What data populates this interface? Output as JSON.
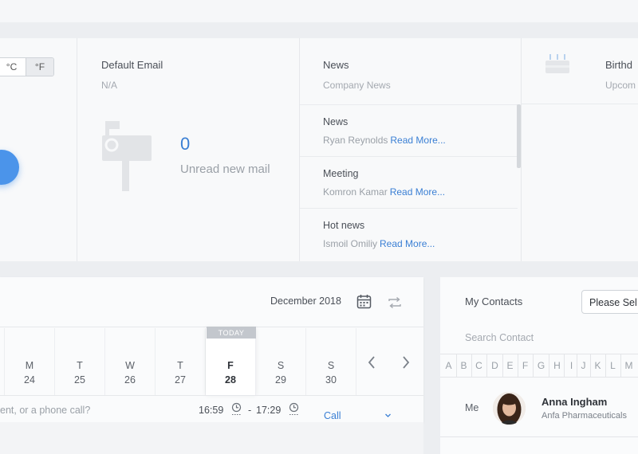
{
  "weather": {
    "units": [
      "°C",
      "°F"
    ],
    "active_unit": "°F"
  },
  "email": {
    "title": "Default Email",
    "address": "N/A",
    "unread_count": "0",
    "unread_caption": "Unread new mail"
  },
  "news": {
    "title": "News",
    "subtitle": "Company News",
    "items": [
      {
        "title": "News",
        "author": "Ryan Reynolds",
        "more": "Read More..."
      },
      {
        "title": "Meeting",
        "author": "Komron Kamar",
        "more": "Read More..."
      },
      {
        "title": "Hot news",
        "author": "Ismoil Omiliy",
        "more": "Read More..."
      }
    ]
  },
  "birthdays": {
    "title": "Birthd",
    "subtitle": "Upcom"
  },
  "calendar": {
    "month_label": "December 2018",
    "today_label": "TODAY",
    "days": [
      {
        "name": "M",
        "date": "24"
      },
      {
        "name": "T",
        "date": "25"
      },
      {
        "name": "W",
        "date": "26"
      },
      {
        "name": "T",
        "date": "27"
      },
      {
        "name": "F",
        "date": "28"
      },
      {
        "name": "S",
        "date": "29"
      },
      {
        "name": "S",
        "date": "30"
      }
    ],
    "event_placeholder": "ent, or a phone call?",
    "start_time": "16:59",
    "time_separator": "-",
    "end_time": "17:29",
    "event_type": "Call"
  },
  "contacts": {
    "title": "My Contacts",
    "select_placeholder": "Please Sel",
    "search_placeholder": "Search Contact",
    "letters": [
      "A",
      "B",
      "C",
      "D",
      "E",
      "F",
      "G",
      "H",
      "I",
      "J",
      "K",
      "L",
      "M"
    ],
    "me_label": "Me",
    "contact_name": "Anna Ingham",
    "contact_company": "Anfa Pharmaceuticals"
  },
  "colors": {
    "accent": "#3a7fd4",
    "weather_circle": "#4b94ea"
  }
}
